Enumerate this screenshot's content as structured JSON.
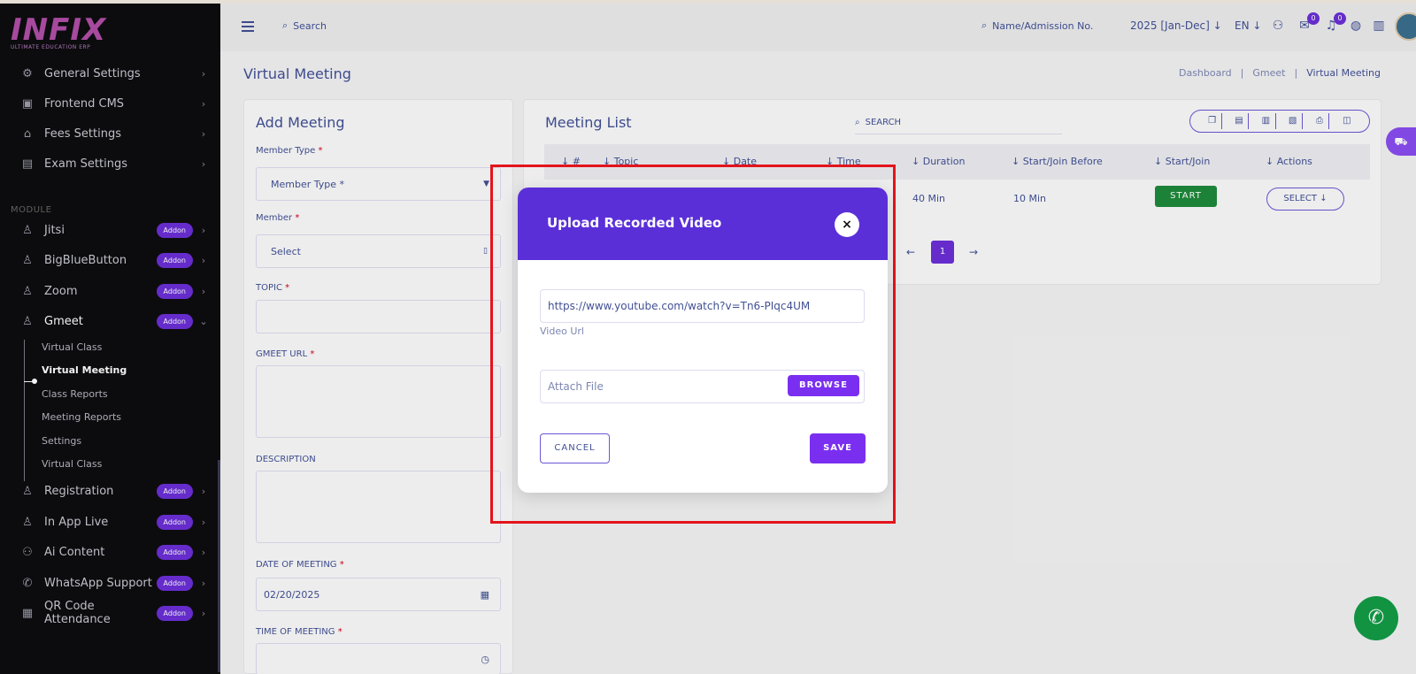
{
  "brand": {
    "logo": "INFIX",
    "tagline": "ULTIMATE EDUCATION ERP"
  },
  "sidebar": {
    "items_top": [
      {
        "label": "General Settings",
        "icon": "gear-icon"
      },
      {
        "label": "Frontend CMS",
        "icon": "cms-icon"
      },
      {
        "label": "Fees Settings",
        "icon": "bank-icon"
      },
      {
        "label": "Exam Settings",
        "icon": "exam-icon"
      }
    ],
    "section_label": "MODULE",
    "addon_label": "Addon",
    "modules": [
      {
        "label": "Jitsi"
      },
      {
        "label": "BigBlueButton"
      },
      {
        "label": "Zoom"
      },
      {
        "label": "Gmeet"
      }
    ],
    "gmeet_sub": [
      "Virtual Class",
      "Virtual Meeting",
      "Class Reports",
      "Meeting Reports",
      "Settings",
      "Virtual Class"
    ],
    "modules_bottom": [
      {
        "label": "Registration"
      },
      {
        "label": "In App Live"
      },
      {
        "label": "Ai Content"
      },
      {
        "label": "WhatsApp Support"
      },
      {
        "label": "QR Code Attendance"
      }
    ]
  },
  "header": {
    "search_placeholder": "Search",
    "name_search": "Name/Admission No.",
    "year": "2025 [Jan-Dec]",
    "lang": "EN",
    "badge_messages": "0",
    "badge_notifications": "0"
  },
  "page": {
    "title": "Virtual Meeting",
    "breadcrumb": [
      "Dashboard",
      "Gmeet",
      "Virtual Meeting"
    ]
  },
  "add_meeting": {
    "title": "Add Meeting",
    "member_type_label": "Member Type",
    "member_type_value": "Member Type *",
    "member_label": "Member",
    "member_value": "Select",
    "topic_label": "TOPIC",
    "gmeet_url_label": "GMEET URL",
    "description_label": "DESCRIPTION",
    "date_label": "DATE OF MEETING",
    "date_value": "02/20/2025",
    "time_label": "TIME OF MEETING",
    "required_mark": "*"
  },
  "meeting_list": {
    "title": "Meeting List",
    "search_placeholder": "SEARCH",
    "columns": [
      "#",
      "Topic",
      "Date",
      "Time",
      "Duration",
      "Start/Join Before",
      "Start/Join",
      "Actions"
    ],
    "row": {
      "duration": "40 Min",
      "join_before": "10 Min",
      "start_label": "START",
      "select_label": "SELECT"
    },
    "page_current": "1"
  },
  "modal": {
    "title": "Upload Recorded Video",
    "video_url_value": "https://www.youtube.com/watch?v=Tn6-PIqc4UM",
    "video_url_label": "Video Url",
    "attach_placeholder": "Attach File",
    "browse_label": "BROWSE",
    "cancel_label": "CANCEL",
    "save_label": "SAVE"
  },
  "colors": {
    "primary": "#5a2fd8",
    "accent": "#7a2ff0",
    "highlight": "#e3141c",
    "success": "#1e8a3a",
    "whatsapp": "#129b45"
  }
}
